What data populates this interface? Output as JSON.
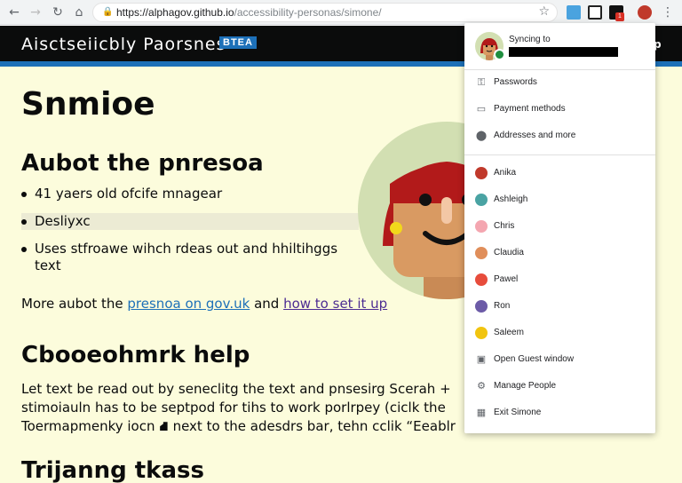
{
  "browser": {
    "url_host": "https://alphagov.github.io",
    "url_path": "/accessibility-personas/simone/",
    "extension_badge": "1"
  },
  "site": {
    "title": "Aisctseiicbly Paorsnes",
    "beta_label": "BTEA",
    "header_right": "p"
  },
  "page": {
    "heading": "Snmioe",
    "about_heading": "Aubot the pnresoa",
    "bullets": [
      "41 yaers old ofcife mnagear",
      "Desliyxc",
      "Uses stfroawe wihch rdeas out and hhiltihggs text"
    ],
    "more_prefix": "More aubot the",
    "more_link1": "presnoa on gov.uk",
    "more_mid": "and",
    "more_link2": "how to set it up",
    "browser_heading": "Cbooeohmrk help",
    "para_lines": [
      "Let text be read out by seneclitg the text and pnsesirg Scerah +",
      "stimoiauln has to be septpod for tihs to work porlrpey (ciclk the",
      "Toermapmenky iocn ⛘ next to the adesdrs bar, tehn cclik “Eeablr"
    ],
    "training_heading": "Trijanng tkass"
  },
  "profile_menu": {
    "sync_label": "Syncing to",
    "items": [
      "Passwords",
      "Payment methods",
      "Addresses and more"
    ],
    "people": [
      "Anika",
      "Ashleigh",
      "Chris",
      "Claudia",
      "Pawel",
      "Ron",
      "Saleem"
    ],
    "actions": [
      "Open Guest window",
      "Manage People",
      "Exit Simone"
    ]
  }
}
